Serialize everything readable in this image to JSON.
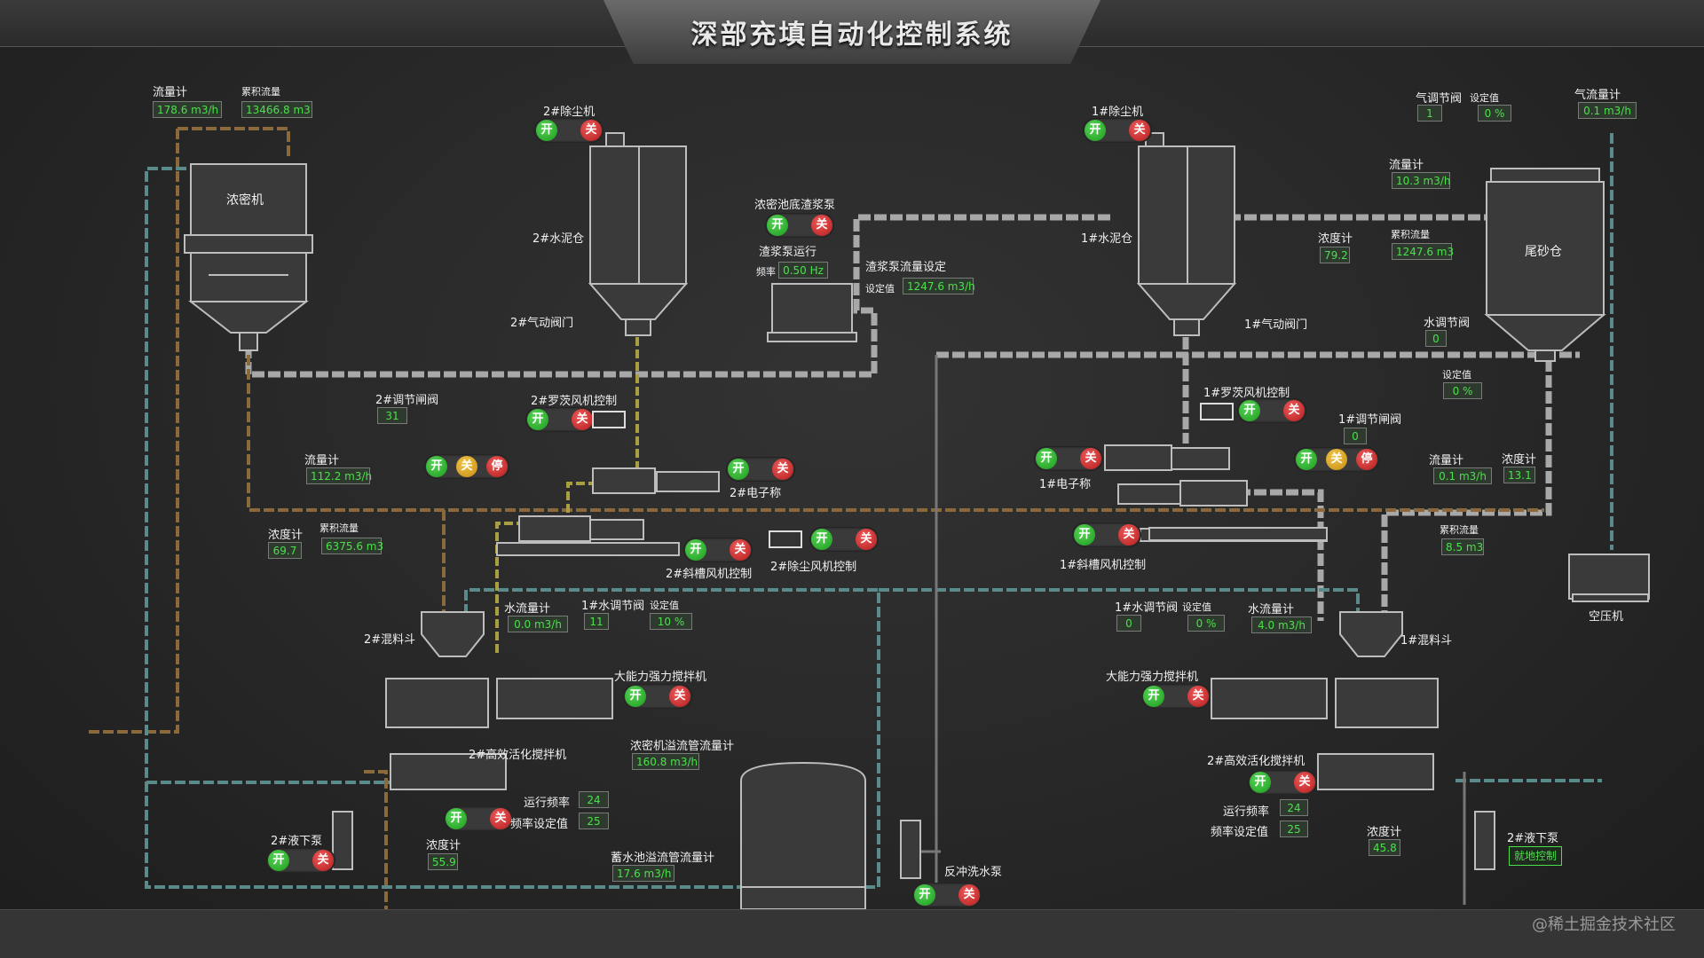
{
  "title": "深部充填自动化控制系统",
  "watermark": "@稀土掘金技术社区",
  "colors": {
    "pipe_grey": "#a8a8a8",
    "pipe_orange": "#8a6a3a",
    "pipe_blue": "#5a8a8a",
    "pipe_yellow": "#a8a040",
    "value_green": "#4be04b",
    "on_green": "#2fb52f",
    "off_red": "#d22a2a",
    "mid_yellow": "#e0a820"
  },
  "buttons": {
    "on": "开",
    "off": "关",
    "stop": "停"
  },
  "left": {
    "flowmeter_top": {
      "label": "流量计",
      "value": "178.6  m3/h"
    },
    "cum_flow_top": {
      "label": "累积流量",
      "value": "13466.8  m3"
    },
    "thickener": "浓密机",
    "cement2": "2#水泥仓",
    "dust2": "2#除尘机",
    "pneu2": "2#气动阀门",
    "regvalve2": {
      "label": "2#调节闸阀",
      "value": "31"
    },
    "flowmeter2": {
      "label": "流量计",
      "value": "112.2  m3/h"
    },
    "density2": {
      "label": "浓度计",
      "value": "69.7"
    },
    "cum_flow2": {
      "label": "累积流量",
      "value": "6375.6  m3"
    },
    "roots2": "2#罗茨风机控制",
    "scale2": "2#电子称",
    "chute_fan2": "2#斜槽风机控制",
    "dust_fan2": "2#除尘风机控制",
    "water_meter2": {
      "label": "水流量计",
      "value": "0.0  m3/h"
    },
    "water_valve1": {
      "label": "1#水调节阀",
      "value": "11"
    },
    "setpoint_a": {
      "label": "设定值",
      "value": "10  %"
    },
    "hopper2": "2#混料斗",
    "mixer_big": "大能力强力搅拌机",
    "activator2": "2#高效活化搅拌机",
    "run_freq": {
      "label": "运行频率",
      "value": "24"
    },
    "freq_set": {
      "label": "频率设定值",
      "value": "25"
    },
    "thick_overflow": {
      "label": "浓密机溢流管流量计",
      "value": "160.8  m3/h"
    },
    "liquid_pump2": "2#液下泵",
    "density_b": {
      "label": "浓度计",
      "value": "55.9"
    },
    "pool_overflow": {
      "label": "蓄水池溢流管流量计",
      "value": "17.6  m3/h"
    },
    "backwash": "反冲洗水泵"
  },
  "center": {
    "slurry_pump": "浓密池底渣浆泵",
    "slurry_run": "渣浆泵运行",
    "freq": {
      "label": "频率",
      "value": "0.50  Hz"
    },
    "flow_set_title": "渣浆泵流量设定",
    "flow_set": {
      "label": "设定值",
      "value": "1247.6  m3/h"
    }
  },
  "right": {
    "dust1": "1#除尘机",
    "cement1": "1#水泥仓",
    "pneu1": "1#气动阀门",
    "gas_valve": {
      "label": "气调节阀",
      "value": "1"
    },
    "gas_set": {
      "label": "设定值",
      "value": "0  %"
    },
    "gas_flow": {
      "label": "气流量计",
      "value": "0.1  m3/h"
    },
    "flowmeter_r": {
      "label": "流量计",
      "value": "10.3  m3/h"
    },
    "density_r": {
      "label": "浓度计",
      "value": "79.2"
    },
    "cum_flow_r": {
      "label": "累积流量",
      "value": "1247.6  m3"
    },
    "tailings": "尾砂仓",
    "water_valve": {
      "label": "水调节阀",
      "value": "0"
    },
    "water_set": {
      "label": "设定值",
      "value": "0  %"
    },
    "roots1": "1#罗茨风机控制",
    "regvalve1": {
      "label": "1#调节闸阀",
      "value": "0"
    },
    "flowmeter1": {
      "label": "流量计",
      "value": "0.1  m3/h"
    },
    "density1": {
      "label": "浓度计",
      "value": "13.1"
    },
    "cum_flow1": {
      "label": "累积流量",
      "value": "8.5  m3"
    },
    "scale1": "1#电子称",
    "chute_fan1": "1#斜槽风机控制",
    "water_valve1b": {
      "label": "1#水调节阀",
      "value": "0"
    },
    "setpoint_b": {
      "label": "设定值",
      "value": "0  %"
    },
    "water_meter1": {
      "label": "水流量计",
      "value": "4.0  m3/h"
    },
    "compressor": "空压机",
    "hopper1": "1#混料斗",
    "mixer_big": "大能力强力搅拌机",
    "activator2": "2#高效活化搅拌机",
    "run_freq": {
      "label": "运行频率",
      "value": "24"
    },
    "freq_set": {
      "label": "频率设定值",
      "value": "25"
    },
    "density": {
      "label": "浓度计",
      "value": "45.8"
    },
    "liquid_pump2": "2#液下泵",
    "local_ctrl": "就地控制"
  }
}
